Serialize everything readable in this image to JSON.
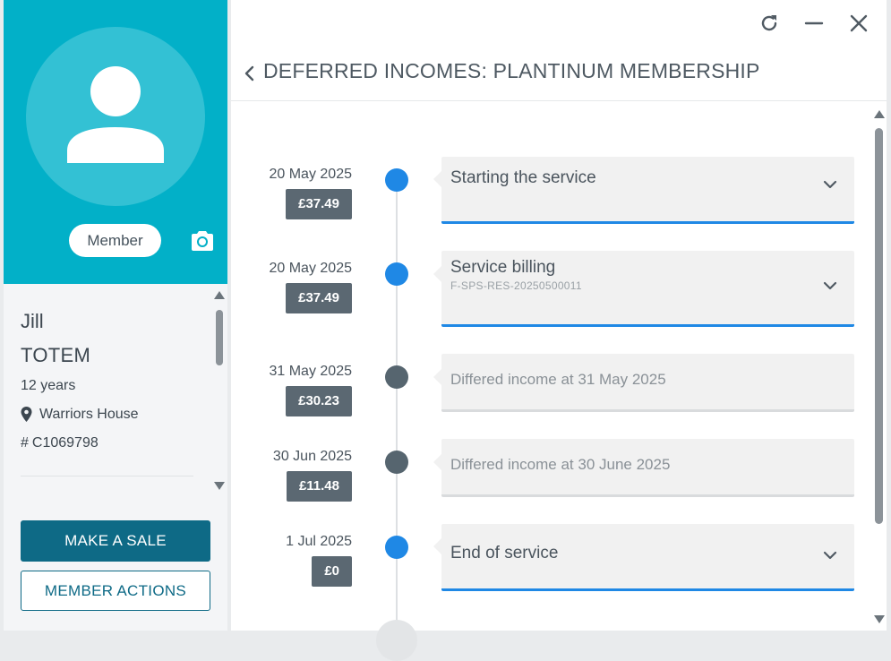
{
  "profile": {
    "badge": "Member",
    "first_name": "Jill",
    "last_name": "TOTEM",
    "age": "12 years",
    "location": "Warriors House",
    "id_prefix": "#",
    "member_id": "C1069798",
    "colors": {
      "header": "#02b0c8",
      "avatar_bg": "#33c1d4"
    }
  },
  "actions": {
    "make_sale": "MAKE A SALE",
    "member_actions": "MEMBER ACTIONS"
  },
  "window": {
    "controls": [
      "refresh-icon",
      "minimize-icon",
      "close-icon"
    ]
  },
  "panel": {
    "title": "DEFERRED INCOMES: PLANTINUM MEMBERSHIP"
  },
  "timeline": [
    {
      "date": "20 May 2025",
      "amount": "£37.49",
      "title": "Starting the service",
      "subtitle": "",
      "dot": "#1f88e5",
      "expandable": true
    },
    {
      "date": "20 May 2025",
      "amount": "£37.49",
      "title": "Service billing",
      "subtitle": "F-SPS-RES-20250500011",
      "dot": "#1f88e5",
      "expandable": true
    },
    {
      "date": "31 May 2025",
      "amount": "£30.23",
      "title": "Differed income at 31 May 2025",
      "subtitle": "",
      "dot": "#56656f",
      "expandable": false
    },
    {
      "date": "30 Jun 2025",
      "amount": "£11.48",
      "title": "Differed income at 30 June 2025",
      "subtitle": "",
      "dot": "#56656f",
      "expandable": false
    },
    {
      "date": "1 Jul 2025",
      "amount": "£0",
      "title": "End of service",
      "subtitle": "",
      "dot": "#1f88e5",
      "expandable": true
    }
  ],
  "accent": "#1f88e5"
}
